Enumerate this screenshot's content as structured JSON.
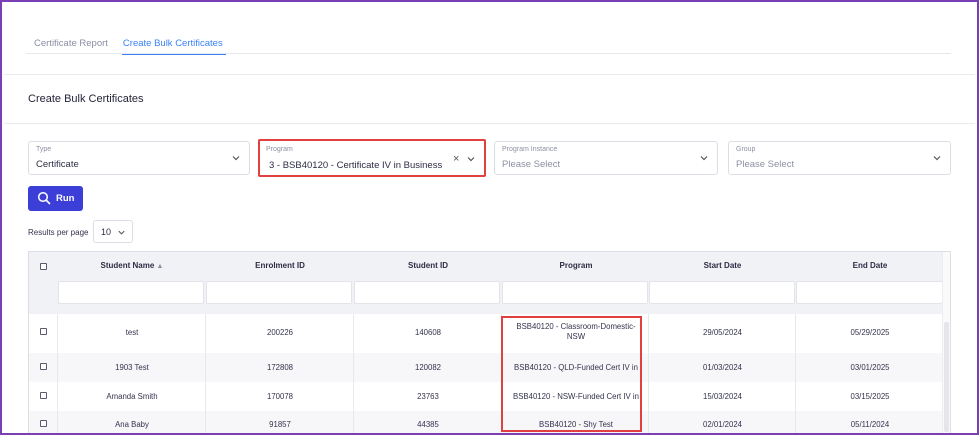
{
  "tabs": [
    {
      "label": "Certificate Report",
      "active": false
    },
    {
      "label": "Create Bulk Certificates",
      "active": true
    }
  ],
  "section_title": "Create Bulk Certificates",
  "filters": {
    "type": {
      "label": "Type",
      "value": "Certificate"
    },
    "program": {
      "label": "Program",
      "value": "3 - BSB40120 - Certificate IV in Business"
    },
    "program_instance": {
      "label": "Program Instance",
      "placeholder": "Please Select"
    },
    "group": {
      "label": "Group",
      "placeholder": "Please Select"
    }
  },
  "run_button": {
    "label": "Run",
    "icon": "search-icon"
  },
  "results_per_page": {
    "label": "Results per page",
    "value": "10"
  },
  "table": {
    "columns": [
      "Student Name",
      "Enrolment ID",
      "Student ID",
      "Program",
      "Start Date",
      "End Date"
    ],
    "sorted_column": "Student Name",
    "rows": [
      {
        "name": "test",
        "enrolment_id": "200226",
        "student_id": "140608",
        "program": "BSB40120 - Classroom-Domestic-NSW",
        "program_line1": "BSB40120 - Classroom-Domestic-",
        "program_line2": "NSW",
        "start_date": "29/05/2024",
        "end_date": "05/29/2025"
      },
      {
        "name": "1903 Test",
        "enrolment_id": "172808",
        "student_id": "120082",
        "program": "BSB40120 - QLD-Funded Cert IV in",
        "start_date": "01/03/2024",
        "end_date": "03/01/2025"
      },
      {
        "name": "Amanda Smith",
        "enrolment_id": "170078",
        "student_id": "23763",
        "program": "BSB40120 - NSW-Funded Cert IV in",
        "start_date": "15/03/2024",
        "end_date": "03/15/2025"
      },
      {
        "name": "Ana Baby",
        "enrolment_id": "91857",
        "student_id": "44385",
        "program": "BSB40120 - Shy Test",
        "start_date": "02/01/2024",
        "end_date": "05/11/2024"
      }
    ]
  },
  "colors": {
    "accent": "#3b82f6",
    "button": "#3b3fd8",
    "highlight": "#e04040",
    "frame": "#7a3fb5"
  }
}
